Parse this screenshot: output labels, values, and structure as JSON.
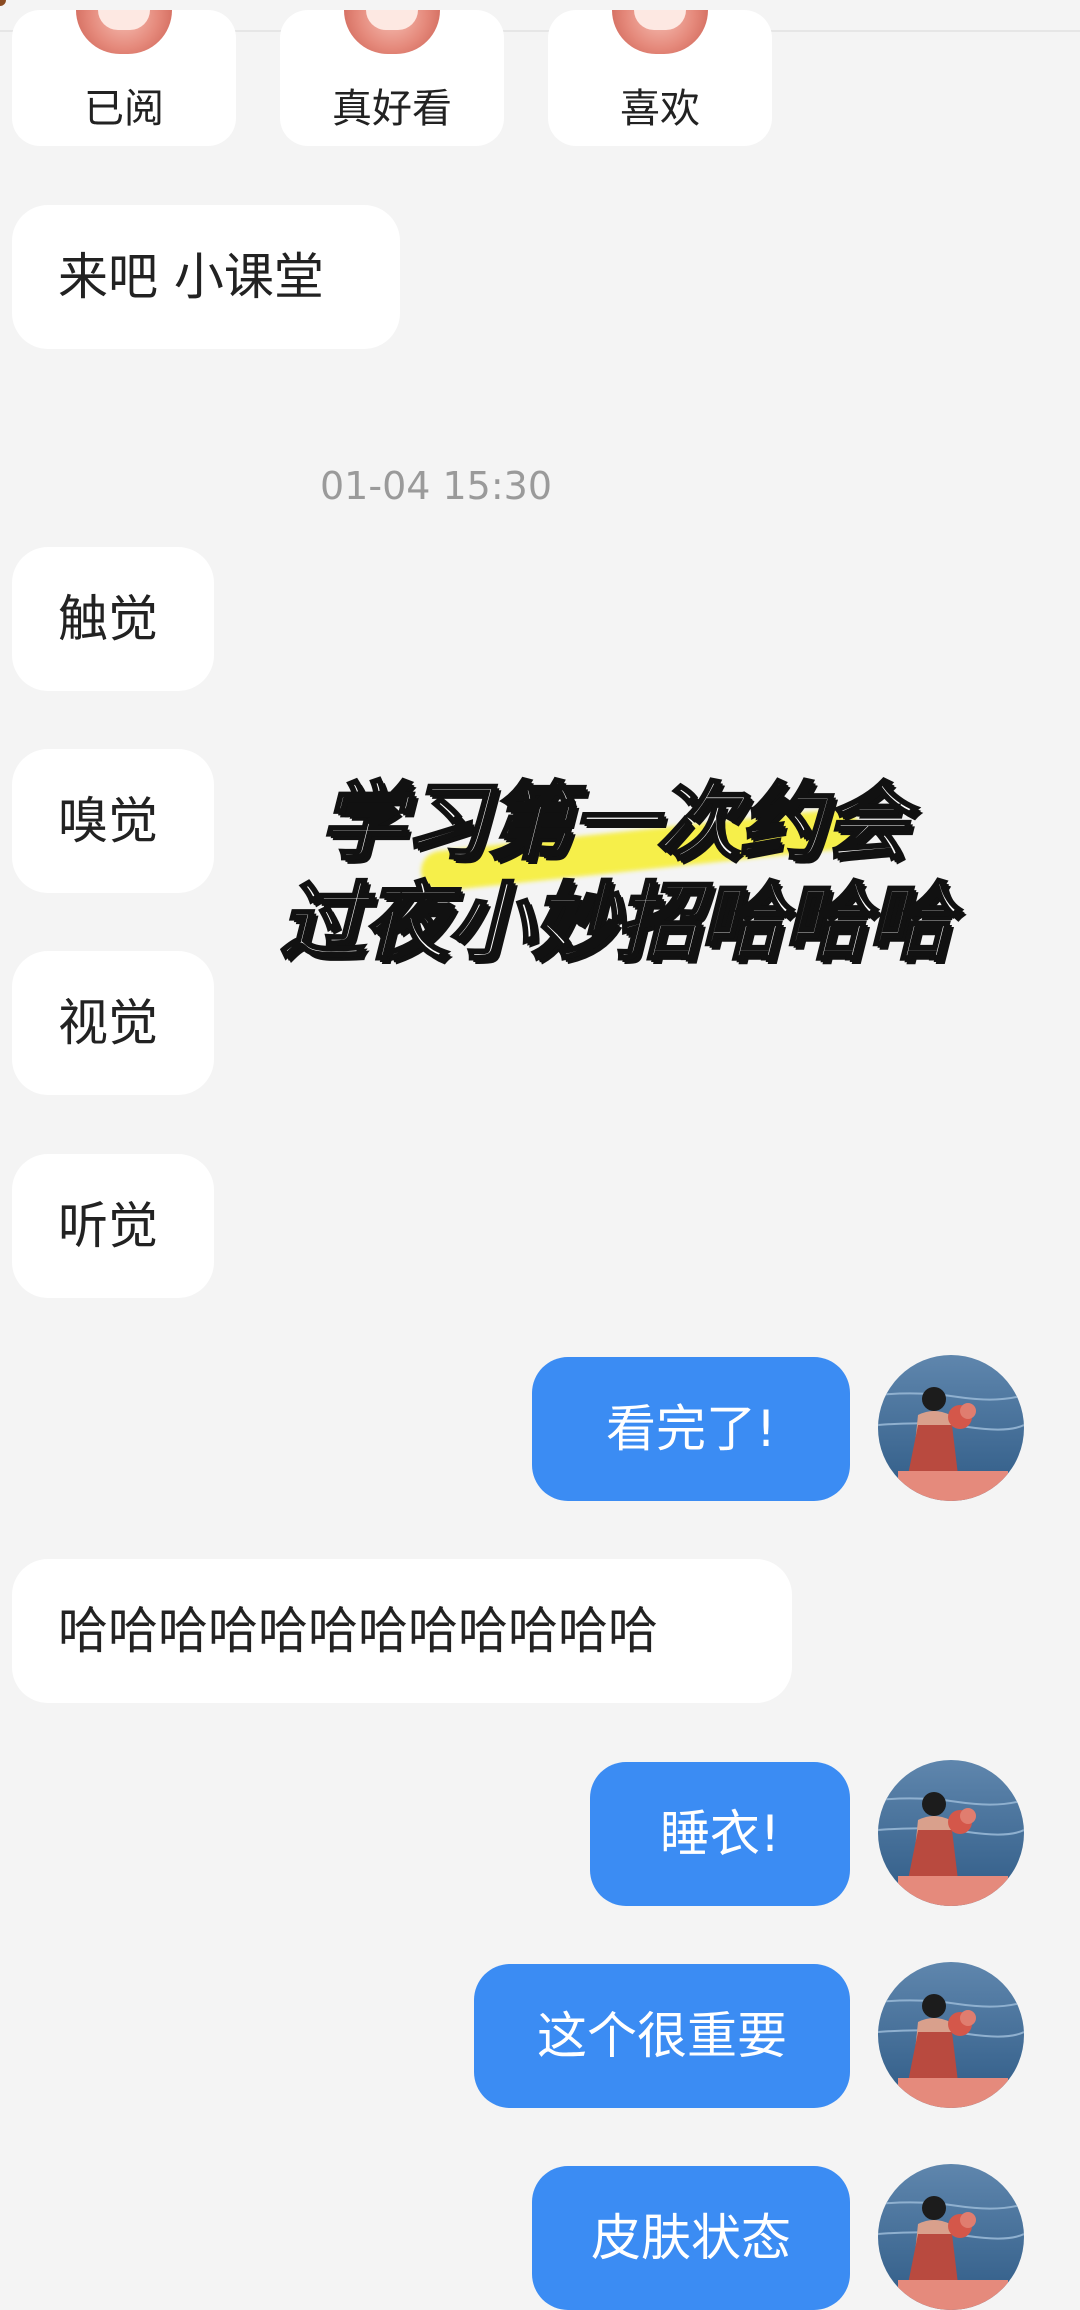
{
  "reactions": [
    {
      "label": "已阅"
    },
    {
      "label": "真好看"
    },
    {
      "label": "喜欢"
    }
  ],
  "messages": {
    "m1": "来吧 小课堂",
    "timestamp": "01-04 15:30",
    "m2": "触觉",
    "m3": "嗅觉",
    "m4": "视觉",
    "m5": "听觉",
    "m6": "看完了!",
    "m7": "哈哈哈哈哈哈哈哈哈哈哈哈",
    "m8": "睡衣!",
    "m9": "这个很重要",
    "m10": "皮肤状态"
  },
  "overlay": {
    "line1": "学习第一次约会",
    "line2": "过夜小妙招哈哈哈"
  },
  "colors": {
    "outgoing_bubble": "#3b8cf3",
    "incoming_bubble": "#ffffff",
    "background": "#f4f4f4"
  }
}
